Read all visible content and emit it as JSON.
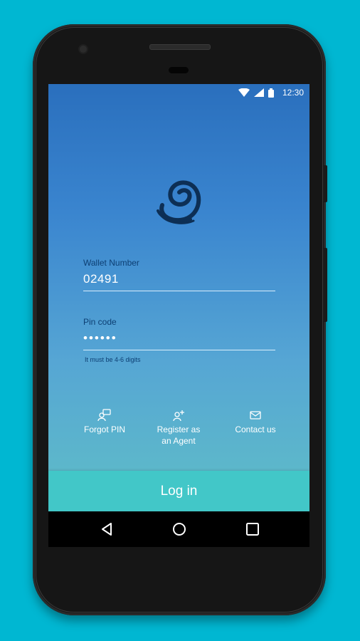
{
  "status_bar": {
    "time": "12:30",
    "icons": [
      "wifi-icon",
      "signal-icon",
      "battery-icon"
    ]
  },
  "logo": {
    "name": "swirl-logo"
  },
  "wallet": {
    "label": "Wallet Number",
    "value": "02491"
  },
  "pin": {
    "label": "Pin code",
    "value": "••••••",
    "helper": "It must be 4-6 digits"
  },
  "actions": {
    "forgot_pin": "Forgot PIN",
    "register_line1": "Register as",
    "register_line2": "an Agent",
    "contact": "Contact us"
  },
  "login_button": "Log in",
  "colors": {
    "background": "#00b7d2",
    "login": "#42c7c8",
    "label": "#0d3f73"
  },
  "nav": {
    "icons": [
      "back-icon",
      "home-icon",
      "recents-icon"
    ]
  }
}
